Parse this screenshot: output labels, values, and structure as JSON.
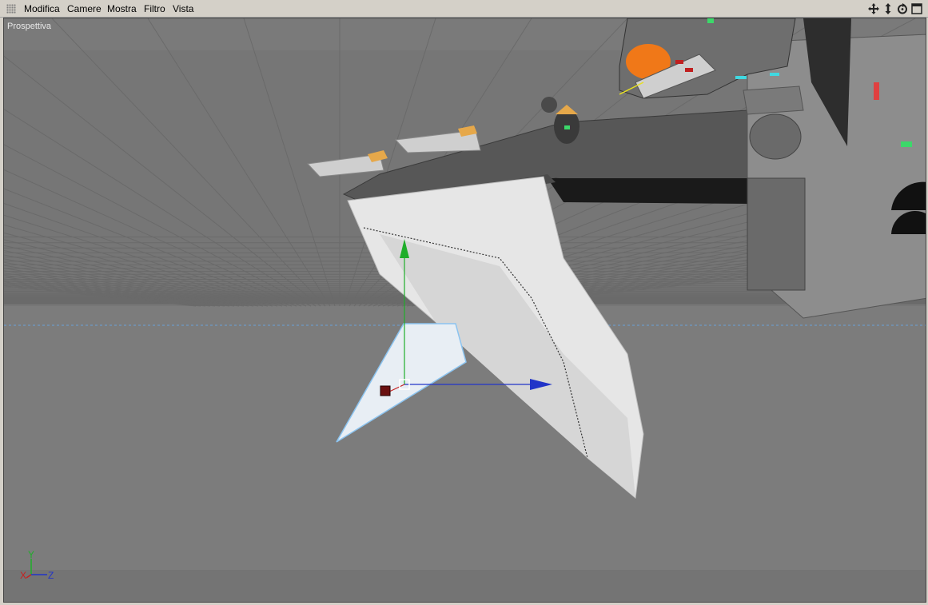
{
  "menu": {
    "items": [
      "Modifica",
      "Camere",
      "Mostra",
      "Filtro",
      "Vista"
    ]
  },
  "toolbar": {
    "icons": [
      "move-view-icon",
      "dolly-view-icon",
      "rotate-view-icon",
      "maximize-view-icon"
    ]
  },
  "viewport": {
    "label": "Prospettiva",
    "axes": {
      "y": "Y",
      "x": "X",
      "z": "Z"
    }
  },
  "colors": {
    "ui_gray": "#d4d0c8",
    "viewport_bg": "#777777",
    "grid": "#6b6b6b",
    "horizon_line": "#6aa0d8",
    "axis_y": "#1fae2a",
    "axis_x": "#c62020",
    "axis_z": "#2234c8",
    "hull": "#5a5a5a",
    "fin": "#dcdcdc",
    "accent_orange": "#f07818"
  }
}
